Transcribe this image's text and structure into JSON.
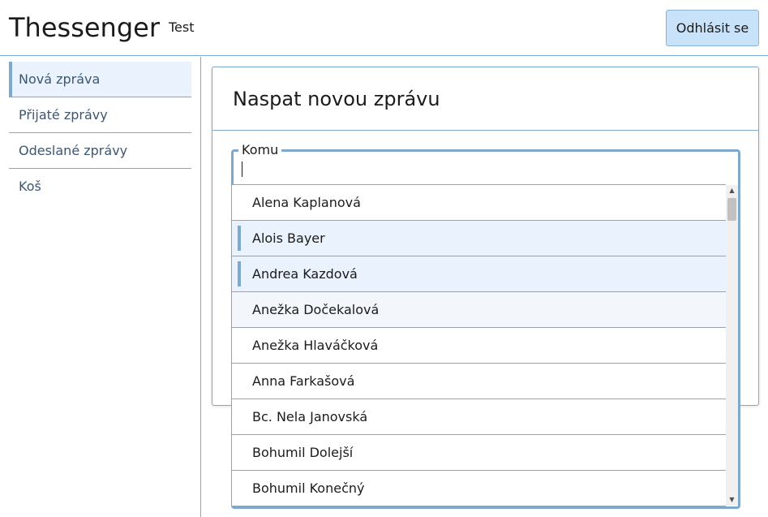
{
  "header": {
    "app_title": "Thessenger",
    "user_name": "Test",
    "logout_label": "Odhlásit se"
  },
  "sidebar": {
    "items": [
      {
        "label": "Nová zpráva",
        "active": true
      },
      {
        "label": "Přijaté zprávy",
        "active": false
      },
      {
        "label": "Odeslané zprávy",
        "active": false
      },
      {
        "label": "Koš",
        "active": false
      }
    ]
  },
  "compose": {
    "title": "Naspat novou zprávu",
    "to_label": "Komu",
    "to_value": ""
  },
  "recipients": {
    "options": [
      {
        "label": "Alena Kaplanová",
        "state": "normal"
      },
      {
        "label": "Alois Bayer",
        "state": "selected"
      },
      {
        "label": "Andrea Kazdová",
        "state": "selected"
      },
      {
        "label": "Anežka Dočekalová",
        "state": "hover"
      },
      {
        "label": "Anežka Hlaváčková",
        "state": "normal"
      },
      {
        "label": "Anna Farkašová",
        "state": "normal"
      },
      {
        "label": "Bc. Nela Janovská",
        "state": "normal"
      },
      {
        "label": "Bohumil Dolejší",
        "state": "normal"
      },
      {
        "label": "Bohumil Konečný",
        "state": "normal"
      }
    ]
  },
  "colors": {
    "accent": "#7fa9cc",
    "button_bg": "#c8e2fa",
    "selected_bg": "#e9f2fd"
  },
  "icons": {
    "scroll_up": "scroll-up-arrow-icon",
    "scroll_down": "scroll-down-arrow-icon"
  }
}
